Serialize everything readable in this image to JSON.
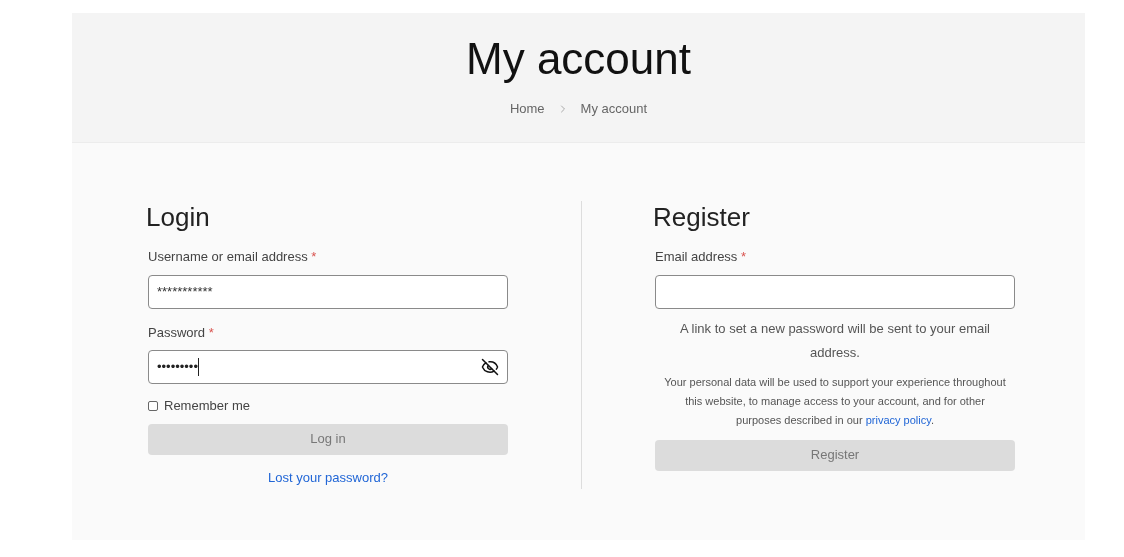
{
  "header": {
    "title": "My account",
    "breadcrumb": [
      "Home",
      "My account"
    ]
  },
  "login": {
    "title": "Login",
    "username": {
      "label": "Username or email address",
      "required_mark": "*",
      "value": "***********"
    },
    "password": {
      "label": "Password",
      "required_mark": "*",
      "value": "•••••••••"
    },
    "remember": {
      "label": "Remember me",
      "checked": false
    },
    "button": "Log in",
    "lost_link": "Lost your password?"
  },
  "register": {
    "title": "Register",
    "email": {
      "label": "Email address",
      "required_mark": "*"
    },
    "notice": "A link to set a new password will be sent to your email address.",
    "privacy": {
      "before": "Your personal data will be used to support your experience throughout this website, to manage access to your account, and for other purposes described in our ",
      "link": "privacy policy",
      "after": "."
    },
    "button": "Register"
  }
}
